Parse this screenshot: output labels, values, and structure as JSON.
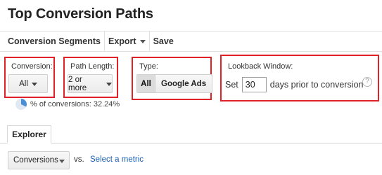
{
  "page": {
    "title": "Top Conversion Paths"
  },
  "toolbar": {
    "segments_label": "Conversion Segments",
    "export_label": "Export",
    "save_label": "Save"
  },
  "filters": {
    "conversion": {
      "label": "Conversion:",
      "value": "All"
    },
    "path_length": {
      "label": "Path Length:",
      "value": "2 or more"
    },
    "type": {
      "label": "Type:",
      "options": [
        "All",
        "Google Ads"
      ],
      "selected": "All"
    },
    "lookback": {
      "label": "Lookback Window:",
      "prefix": "Set",
      "days": "30",
      "suffix": "days prior to conversion",
      "help_glyph": "?"
    }
  },
  "summary": {
    "percent_text": "% of conversions: 32.24%",
    "percent_value": 32.24
  },
  "tabs": [
    {
      "label": "Explorer"
    }
  ],
  "metric": {
    "select_value": "Conversions",
    "vs_label": "vs.",
    "select_link": "Select a metric"
  },
  "colors": {
    "highlight_border": "#e02128",
    "link": "#1a5fb4",
    "pie_fill": "#4a8fd6"
  }
}
